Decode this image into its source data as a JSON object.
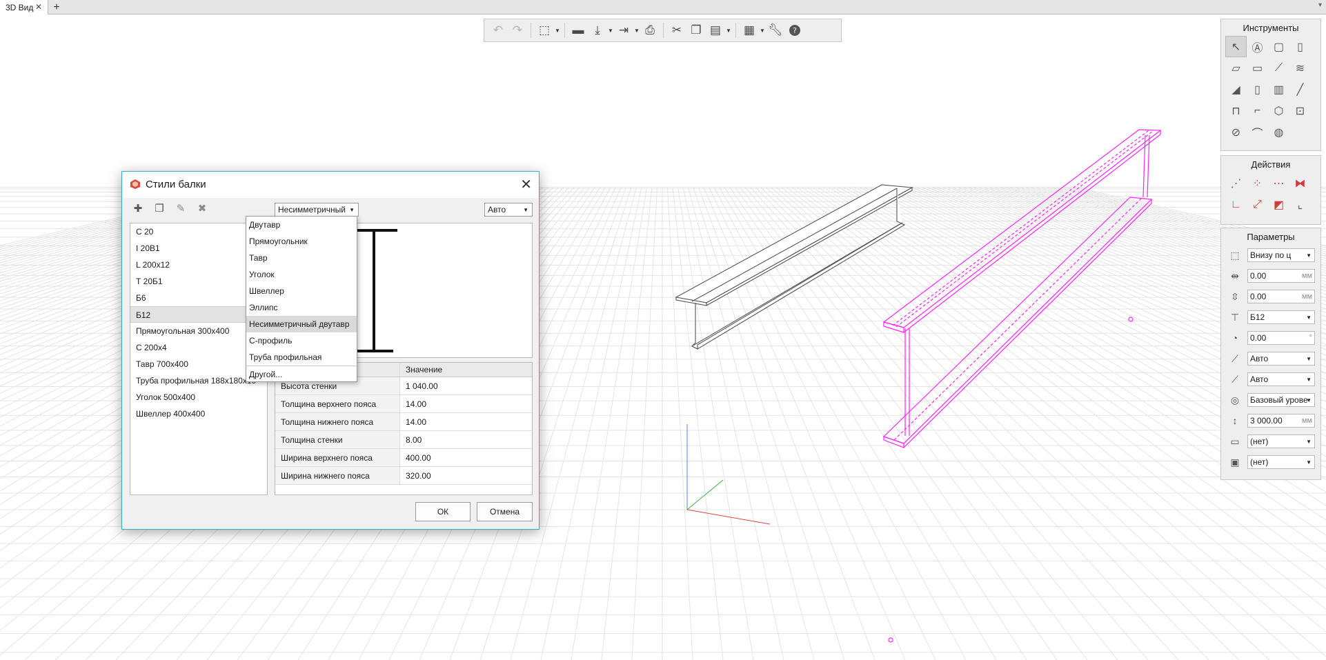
{
  "tabs": [
    {
      "label": "3D Вид"
    }
  ],
  "tabbar": {
    "close_glyph": "✕",
    "add_glyph": "+",
    "menu_glyph": "▾"
  },
  "toolbar": {
    "items": [
      "undo-icon",
      "redo-icon",
      "view-cube-icon",
      "open-folder-icon",
      "import-icon",
      "export-icon",
      "print-icon",
      "cut-icon",
      "copy-icon",
      "paste-icon",
      "properties-icon",
      "settings-wrench-icon",
      "help-icon"
    ]
  },
  "panels": {
    "instruments": {
      "title": "Инструменты"
    },
    "actions": {
      "title": "Действия"
    },
    "params": {
      "title": "Параметры",
      "rows": [
        {
          "icon": "alignment-icon",
          "value": "Внизу по ц",
          "unit": "",
          "dropdown": true
        },
        {
          "icon": "offset-x-icon",
          "value": "0.00",
          "unit": "мм",
          "dropdown": false
        },
        {
          "icon": "offset-y-icon",
          "value": "0.00",
          "unit": "мм",
          "dropdown": false
        },
        {
          "icon": "beam-style-icon",
          "value": "Б12",
          "unit": "",
          "dropdown": true
        },
        {
          "icon": "rotation-icon",
          "value": "0.00",
          "unit": "°",
          "dropdown": false
        },
        {
          "icon": "start-cut-icon",
          "value": "Авто",
          "unit": "",
          "dropdown": true
        },
        {
          "icon": "end-cut-icon",
          "value": "Авто",
          "unit": "",
          "dropdown": true
        },
        {
          "icon": "level-icon",
          "value": "Базовый урове",
          "unit": "",
          "dropdown": true
        },
        {
          "icon": "height-icon",
          "value": "3 000.00",
          "unit": "мм",
          "dropdown": false
        },
        {
          "icon": "material-icon",
          "value": "(нет)",
          "unit": "",
          "dropdown": true
        },
        {
          "icon": "label-tag-icon",
          "value": "(нет)",
          "unit": "",
          "dropdown": true
        }
      ]
    }
  },
  "dialog": {
    "title": "Стили балки",
    "close_glyph": "✕",
    "type_combo": "Несимметричный",
    "mode_combo": "Авто",
    "styles": [
      "С 20",
      "I 20B1",
      "L 200x12",
      "Т 20Б1",
      "Б6",
      "Б12",
      "Прямоугольная 300x400",
      "С 200x4",
      "Тавр 700x400",
      "Труба профильная 188x180x10",
      "Уголок 500x400",
      "Швеллер 400x400"
    ],
    "selected_style": "Б12",
    "dropdown_options": [
      "Двутавр",
      "Прямоугольник",
      "Тавр",
      "Уголок",
      "Швеллер",
      "Эллипс",
      "Несимметричный двутавр",
      "С-профиль",
      "Труба профильная",
      "Другой..."
    ],
    "dropdown_selected": "Несимметричный двутавр",
    "table": {
      "header": [
        "",
        "Значение"
      ],
      "rows": [
        [
          "Высота стенки",
          "1 040.00"
        ],
        [
          "Толщина верхнего пояса",
          "14.00"
        ],
        [
          "Толщина нижнего пояса",
          "14.00"
        ],
        [
          "Толщина стенки",
          "8.00"
        ],
        [
          "Ширина верхнего пояса",
          "400.00"
        ],
        [
          "Ширина нижнего пояса",
          "320.00"
        ]
      ]
    },
    "ok_label": "ОК",
    "cancel_label": "Отмена"
  },
  "colors": {
    "selection": "#ff22ff",
    "dialog_border": "#2fb0c8",
    "axis_x": "#e04040",
    "axis_y": "#3fa83f",
    "axis_z": "#5b7fe0"
  }
}
